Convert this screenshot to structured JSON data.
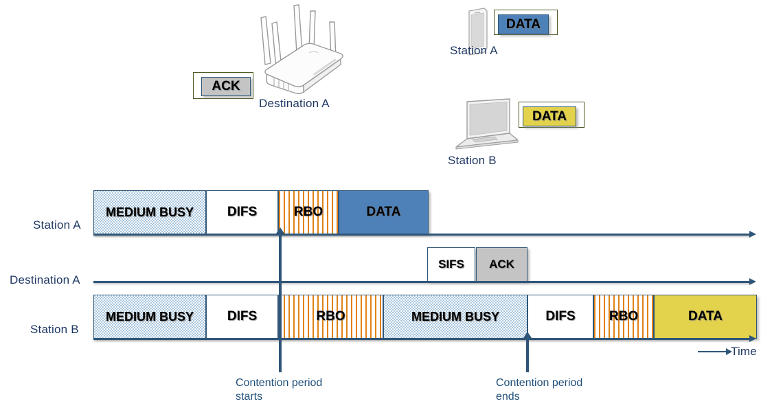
{
  "devices": [
    {
      "name": "Destination A",
      "icon": "wireless-router-icon",
      "chip": "ACK",
      "chip_color": "#c4c4c4"
    },
    {
      "name": "Station A",
      "icon": "smartphone-icon",
      "chip": "DATA",
      "chip_color": "#4e81b8"
    },
    {
      "name": "Station B",
      "icon": "laptop-icon",
      "chip": "DATA",
      "chip_color": "#e3d24c"
    }
  ],
  "rows": [
    {
      "label": "Station A",
      "blocks": [
        {
          "text": "MEDIUM BUSY",
          "fill": "busy"
        },
        {
          "text": "DIFS",
          "fill": "white"
        },
        {
          "text": "RBO",
          "fill": "rbo"
        },
        {
          "text": "DATA",
          "fill": "blue"
        }
      ]
    },
    {
      "label": "Destination A",
      "blocks": [
        {
          "text": "SIFS",
          "fill": "white"
        },
        {
          "text": "ACK",
          "fill": "gray"
        }
      ]
    },
    {
      "label": "Station B",
      "blocks": [
        {
          "text": "MEDIUM BUSY",
          "fill": "busy"
        },
        {
          "text": "DIFS",
          "fill": "white"
        },
        {
          "text": "RBO",
          "fill": "rbo"
        },
        {
          "text": "MEDIUM BUSY",
          "fill": "busy"
        },
        {
          "text": "DIFS",
          "fill": "white"
        },
        {
          "text": "RBO",
          "fill": "rbo"
        },
        {
          "text": "DATA",
          "fill": "yellow"
        }
      ]
    }
  ],
  "markers": [
    {
      "text": "Contention period\nstarts"
    },
    {
      "text": "Contention period\nends"
    }
  ],
  "axis_label": "Time",
  "colors": {
    "line": "#2f5679",
    "label_text": "#1f3864",
    "annotation_text": "#1f4e79",
    "busy_fill": "#a9c6de",
    "rbo_stripe": "#e08214",
    "data_a": "#4e81b8",
    "data_b": "#e3d24c",
    "ack_fill": "#c4c4c4",
    "callout_border": "#4a5a22"
  }
}
